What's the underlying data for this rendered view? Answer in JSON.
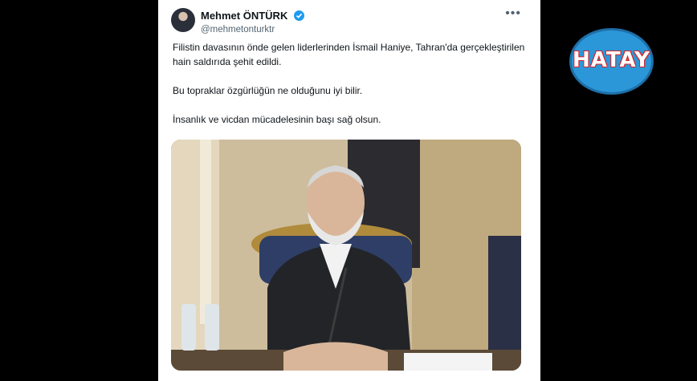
{
  "tweet": {
    "author": {
      "display_name": "Mehmet ÖNTÜRK",
      "handle": "@mehmetonturktr"
    },
    "text": [
      "Filistin davasının önde gelen liderlerinden İsmail Haniye, Tahran'da gerçekleştirilen hain saldırıda şehit edildi.",
      "Bu topraklar özgürlüğün ne olduğunu iyi bilir.",
      "İnsanlık ve vicdan mücadelesinin başı sağ olsun."
    ]
  },
  "channel_logo": {
    "text": "HATAY"
  },
  "icons": {
    "verified": "verified-badge-icon",
    "more": "more-options-icon"
  },
  "colors": {
    "verified": "#1d9bf0",
    "logo_bg": "#2b97d8",
    "logo_outline": "#d8242b"
  }
}
